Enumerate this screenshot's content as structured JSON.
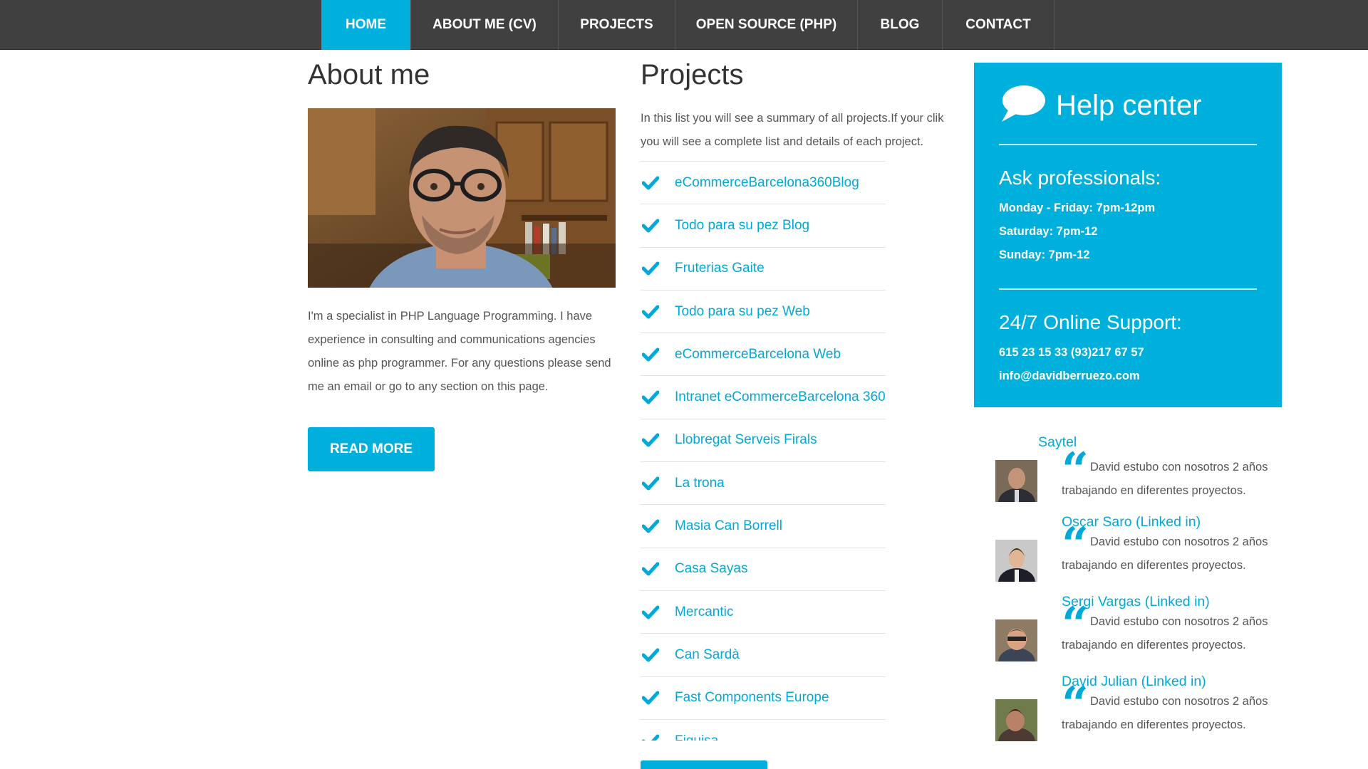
{
  "nav": {
    "items": [
      {
        "label": "HOME",
        "active": true
      },
      {
        "label": "ABOUT ME (CV)",
        "active": false
      },
      {
        "label": "PROJECTS",
        "active": false
      },
      {
        "label": "OPEN SOURCE (PHP)",
        "active": false
      },
      {
        "label": "BLOG",
        "active": false
      },
      {
        "label": "CONTACT",
        "active": false
      }
    ]
  },
  "about": {
    "title": "About me",
    "text": "I'm a specialist in PHP Language Programming. I have experience in consulting and communications agencies online as php programmer. For any questions please send me an email or go to any section on this page.",
    "button": "READ MORE"
  },
  "projects": {
    "title": "Projects",
    "intro": "In this list you will see a summary of all projects.If your clik you will see a complete list and details of each project.",
    "items": [
      "eCommerceBarcelona360Blog",
      "Todo para su pez Blog",
      "Fruterias Gaite",
      "Todo para su pez Web",
      "eCommerceBarcelona Web",
      "Intranet eCommerceBarcelona 360",
      "Llobregat Serveis Firals",
      "La trona",
      "Masia Can Borrell",
      "Casa Sayas",
      "Mercantic",
      "Can Sardà",
      "Fast Components Europe",
      "Fiquisa"
    ]
  },
  "help": {
    "title": "Help center",
    "ask_title": "Ask professionals:",
    "hours": [
      "Monday - Friday: 7pm-12pm",
      "Saturday: 7pm-12",
      "Sunday: 7pm-12"
    ],
    "support_title": "24/7 Online Support:",
    "phone": "615 23 15 33 (93)217 67 57",
    "email": "info@davidberruezo.com"
  },
  "testimonials": [
    {
      "name": "Saytel",
      "quote": "David estubo con nosotros 2 años trabajando en diferentes proyectos."
    },
    {
      "name": "Oscar Saro (Linked in)",
      "quote": "David estubo con nosotros 2 años trabajando en diferentes proyectos."
    },
    {
      "name": "Sergi Vargas (Linked in)",
      "quote": "David estubo con nosotros 2 años trabajando en diferentes proyectos."
    },
    {
      "name": "David Julian (Linked in)",
      "quote": "David estubo con nosotros 2 años trabajando en diferentes proyectos."
    }
  ],
  "colors": {
    "accent": "#00b0dc",
    "nav_bg": "#404040",
    "text": "#555555"
  },
  "icons": {
    "project_item": "checkmark-icon",
    "help": "speech-bubble-icon",
    "testimonial": "quote-icon"
  }
}
